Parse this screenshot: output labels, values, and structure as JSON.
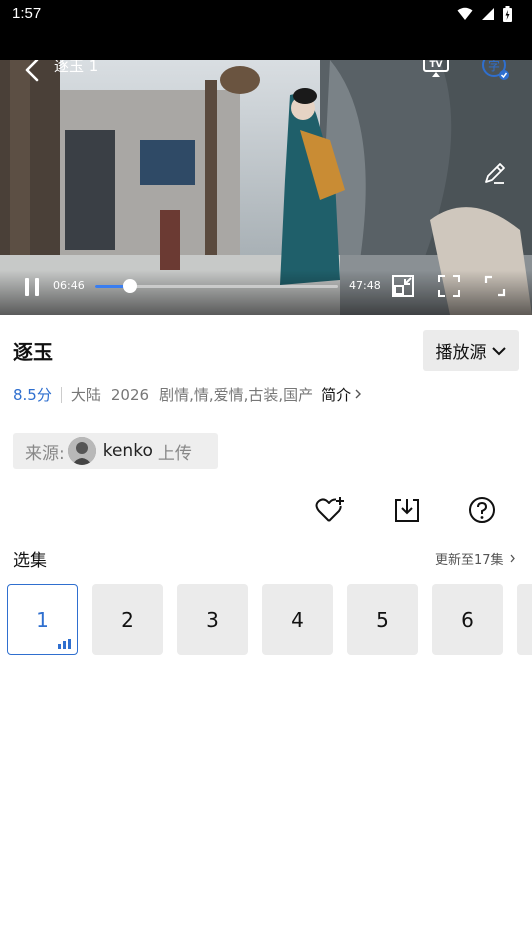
{
  "status_bar": {
    "time": "1:57"
  },
  "player": {
    "title": "逐玉 1",
    "current_time": "06:46",
    "total_time": "47:48",
    "progress": 0.142
  },
  "show": {
    "title": "逐玉",
    "source_button": "播放源",
    "score": "8.5分",
    "region": "大陆",
    "year": "2026",
    "genres": "剧情,情,爱情,古装,国产",
    "intro_label": "简介"
  },
  "uploader": {
    "label": "来源:",
    "name": "kenko",
    "suffix": "上传"
  },
  "episodes": {
    "section_label": "选集",
    "update_text": "更新至17集",
    "items": [
      "1",
      "2",
      "3",
      "4",
      "5",
      "6"
    ],
    "active_index": 0
  },
  "colors": {
    "accent": "#2f6fcf",
    "progress": "#3a7ef0"
  }
}
